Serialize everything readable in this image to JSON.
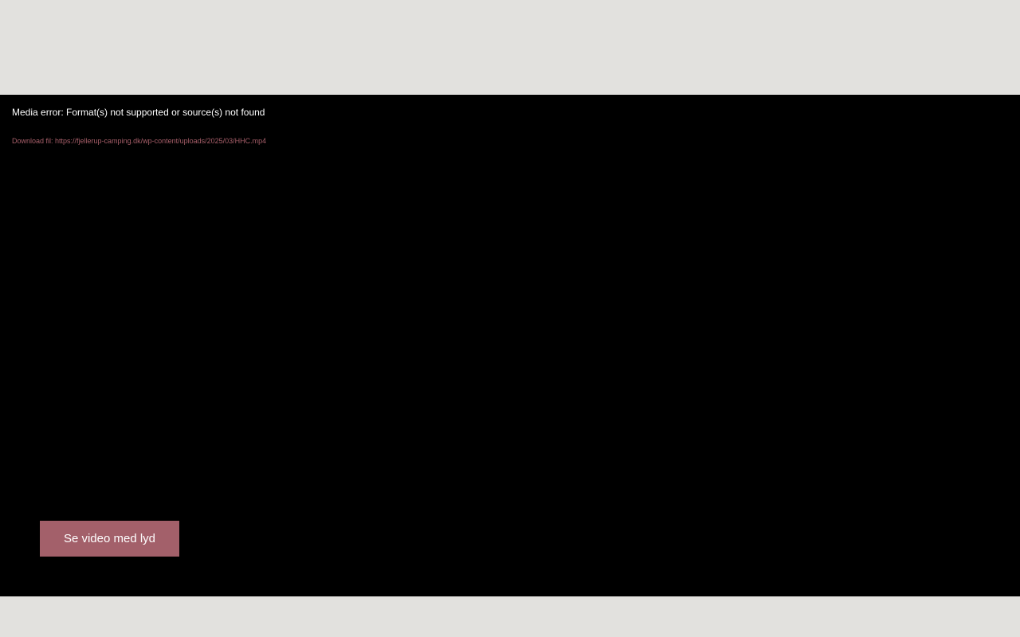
{
  "player": {
    "error_message": "Media error: Format(s) not supported or source(s) not found",
    "download_prefix": "Download fil: ",
    "download_url": "https://fjellerup-camping.dk/wp-content/uploads/2025/03/HHC.mp4"
  },
  "sound_button": {
    "label": "Se video med lyd"
  },
  "colors": {
    "page_background": "#e2e1de",
    "player_background": "#000000",
    "accent": "#a3606a"
  }
}
